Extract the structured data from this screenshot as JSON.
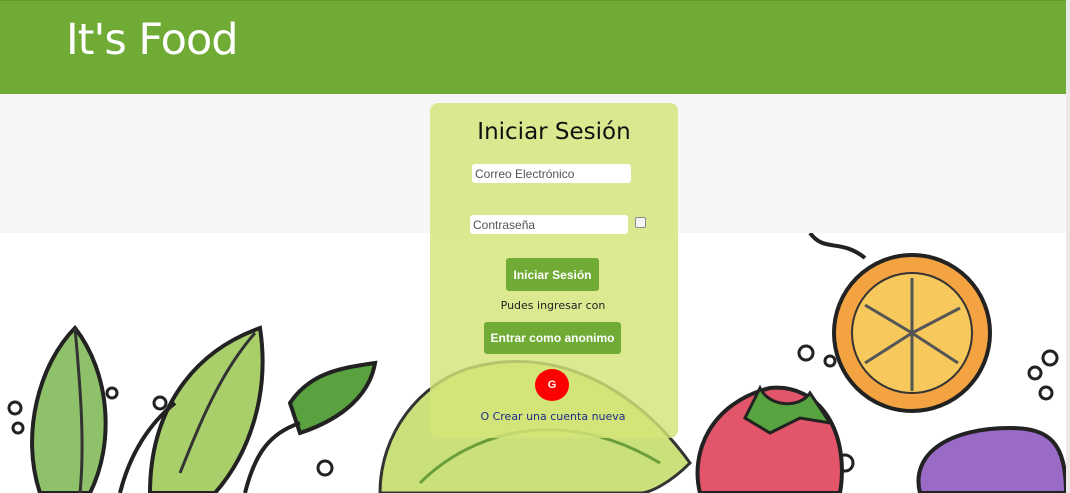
{
  "header": {
    "brand": "It's Food"
  },
  "login": {
    "title": "Iniciar Sesión",
    "email_placeholder": "Correo Electrónico",
    "password_placeholder": "Contraseña",
    "login_button": "Iniciar Sesión",
    "alt_text": "Pudes ingresar con",
    "anonymous_button": "Entrar como anonimo",
    "google_button": "G",
    "create_account": "O Crear una cuenta nueva"
  },
  "colors": {
    "header_green": "#6fab35",
    "card_bg": "#d6e478",
    "google_red": "#ff0000",
    "link_blue": "#1f2b8a"
  },
  "icons": [
    "show-password-checkbox",
    "vegetable-watercolor-illustration"
  ]
}
